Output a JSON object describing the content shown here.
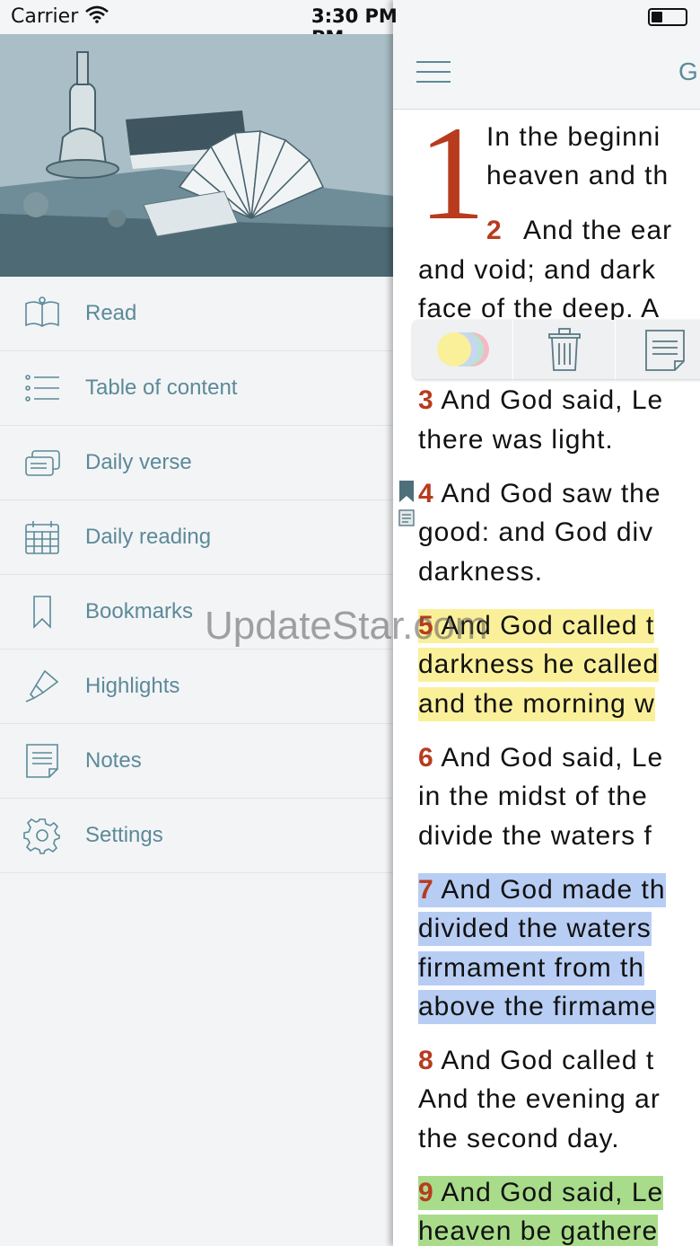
{
  "status_bar": {
    "carrier": "Carrier",
    "time": "3:30 PM"
  },
  "drawer": {
    "menu": [
      {
        "label": "Read",
        "icon": "open-book-icon"
      },
      {
        "label": "Table of content",
        "icon": "list-icon"
      },
      {
        "label": "Daily verse",
        "icon": "cards-icon"
      },
      {
        "label": "Daily reading",
        "icon": "calendar-icon"
      },
      {
        "label": "Bookmarks",
        "icon": "bookmark-icon"
      },
      {
        "label": "Highlights",
        "icon": "highlighter-icon"
      },
      {
        "label": "Notes",
        "icon": "note-icon"
      },
      {
        "label": "Settings",
        "icon": "gear-icon"
      }
    ]
  },
  "reader": {
    "title": "G",
    "chapter": "1",
    "lines": {
      "v1a": "In the beginni",
      "v1b": "heaven and th",
      "v2num": "2",
      "v2a": "And the ear",
      "v2b": "and void; and dark",
      "v2c": "face of the deep. A",
      "v3num": "3",
      "v3a": "And God said, Le",
      "v3b": "there was light.",
      "v4num": "4",
      "v4a": "And God saw the",
      "v4b": "good: and God div",
      "v4c": "darkness.",
      "v5num": "5",
      "v5a": "And God called t",
      "v5b": "darkness he called",
      "v5c": "and the morning w",
      "v6num": "6",
      "v6a": "And God said, Le",
      "v6b": "in the midst of the",
      "v6c": "divide the waters f",
      "v7num": "7",
      "v7a": "And God made th",
      "v7b": "divided the waters",
      "v7c": "firmament from th",
      "v7d": "above the firmame",
      "v8num": "8",
      "v8a": "And God called t",
      "v8b": "And the evening ar",
      "v8c": "the second day.",
      "v9num": "9",
      "v9a": "And God said, Le",
      "v9b": "heaven be gathere"
    },
    "highlight_colors": {
      "yellow": "#fbf09a",
      "blue": "#b7cdf3",
      "green": "#a8dc8a"
    }
  },
  "watermark": "UpdateStar.com"
}
